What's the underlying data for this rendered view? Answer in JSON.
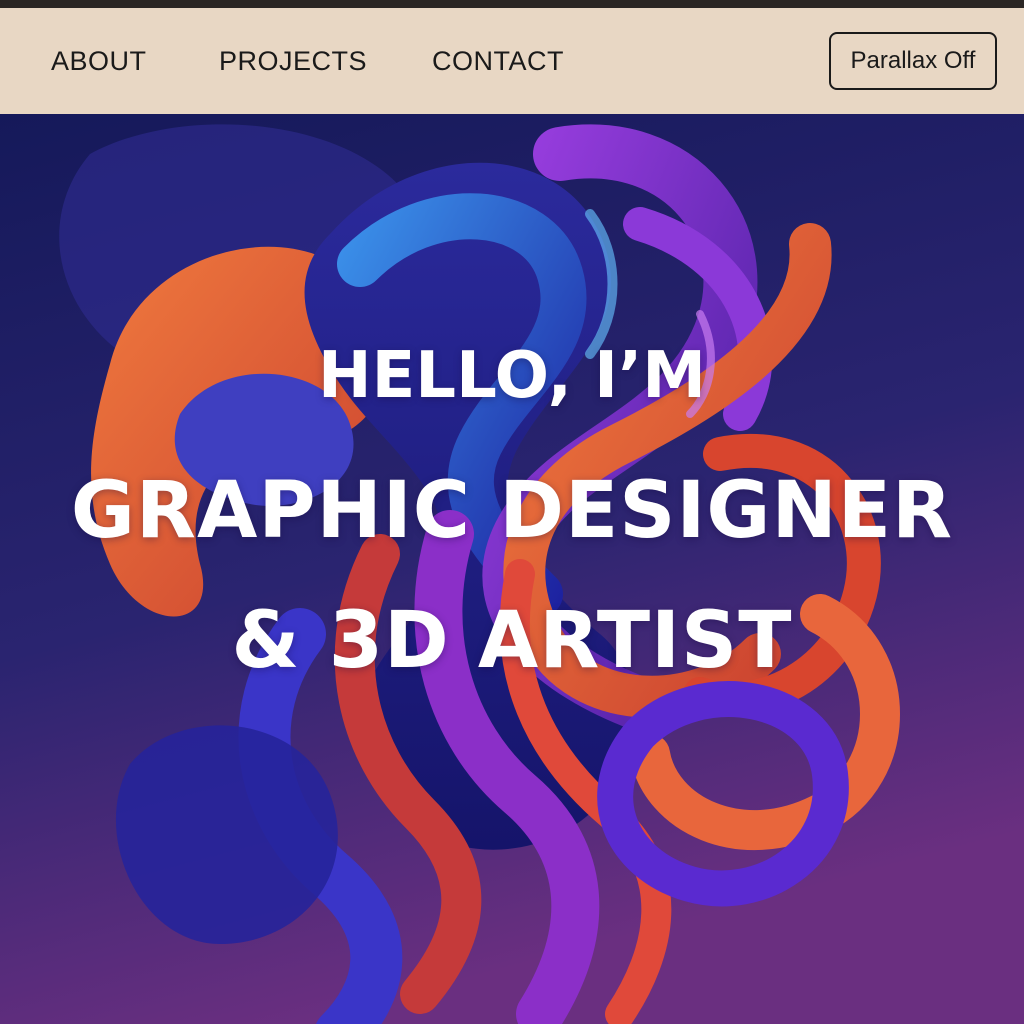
{
  "nav": {
    "links": [
      {
        "label": "ABOUT"
      },
      {
        "label": "PROJECTS"
      },
      {
        "label": "CONTACT"
      }
    ],
    "parallax_toggle_label": "Parallax Off"
  },
  "hero": {
    "greeting": "HELLO, I’M",
    "title_line1": "GRAPHIC DESIGNER",
    "title_line2": "& 3D ARTIST"
  },
  "colors": {
    "navbar_background": "#e8d7c4",
    "hero_background_top": "#1b1f5c",
    "hero_background_bottom": "#6a2f80",
    "accent_orange": "#e8663c",
    "accent_purple": "#7a2fd0",
    "accent_blue": "#2a36c8",
    "text_dark": "#1a1a1a",
    "text_light": "#ffffff"
  }
}
